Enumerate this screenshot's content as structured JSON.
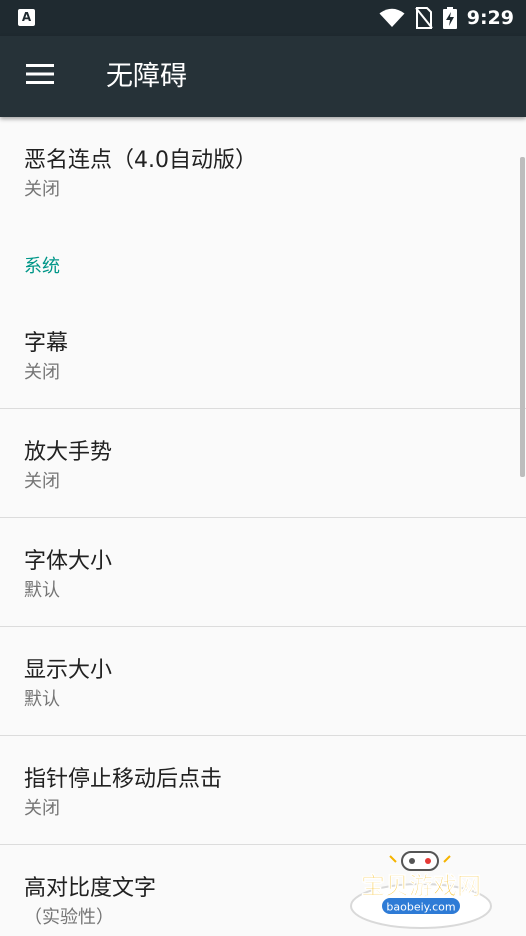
{
  "status_bar": {
    "app_icon_letter": "A",
    "time": "9:29"
  },
  "toolbar": {
    "title": "无障碍"
  },
  "list": {
    "items": [
      {
        "title": "恶名连点（4.0自动版）",
        "summary": "关闭"
      },
      {
        "title": "字幕",
        "summary": "关闭"
      },
      {
        "title": "放大手势",
        "summary": "关闭"
      },
      {
        "title": "字体大小",
        "summary": "默认"
      },
      {
        "title": "显示大小",
        "summary": "默认"
      },
      {
        "title": "指针停止移动后点击",
        "summary": "关闭"
      },
      {
        "title": "高对比度文字",
        "summary": "（实验性）"
      }
    ],
    "category_system": "系统"
  },
  "watermark": {
    "text": "宝贝游戏网",
    "subtext": "baobeiy.com"
  },
  "colors": {
    "status_bar_bg": "#1f2a30",
    "toolbar_bg": "#263238",
    "accent": "#009688",
    "background": "#fafafa",
    "title_text": "#212121",
    "summary_text": "#757575"
  }
}
